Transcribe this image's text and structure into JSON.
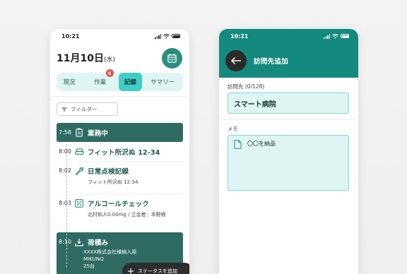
{
  "left_phone": {
    "status_time": "10:21",
    "date": {
      "month_day": "11月10日",
      "weekday": "(水)"
    },
    "tabs": [
      {
        "label": "現況"
      },
      {
        "label": "作業",
        "badge": "6"
      },
      {
        "label": "記録",
        "active": true
      },
      {
        "label": "サマリー"
      }
    ],
    "filter_label": "フィルター",
    "timeline": [
      {
        "time": "7:58",
        "icon": "clipboard-icon",
        "title": "業務中",
        "highlight": true
      },
      {
        "time": "8:00",
        "icon": "car-icon",
        "title": "フィット所沢ぬ 12-34"
      },
      {
        "time": "8:02",
        "icon": "wrench-icon",
        "title": "日常点検記録",
        "sub": "フィット所沢ぬ 12-34"
      },
      {
        "time": "8:03",
        "icon": "percent-icon",
        "title": "アルコールチェック",
        "sub": "北村和人0.00mg / 立会者：本野締"
      },
      {
        "time": "8:10",
        "icon": "download-icon",
        "title": "荷積み",
        "sub_lines": [
          "XXXX株式会社様納入用",
          "MIKUNI2",
          "25台"
        ],
        "highlight": true
      }
    ],
    "fab_label": "ステータスを追加"
  },
  "right_phone": {
    "status_time": "10:21",
    "header_title": "訪問先追加",
    "visit_field": {
      "label": "訪問先 (0/128)",
      "value": "スマート病院"
    },
    "memo_field": {
      "label": "メモ",
      "value": "〇〇を納品"
    }
  },
  "colors": {
    "accent_teal": "#138a7d",
    "tab_active": "#3fcdc4",
    "timeline_block": "#2f6b63",
    "badge_red": "#e65050"
  }
}
